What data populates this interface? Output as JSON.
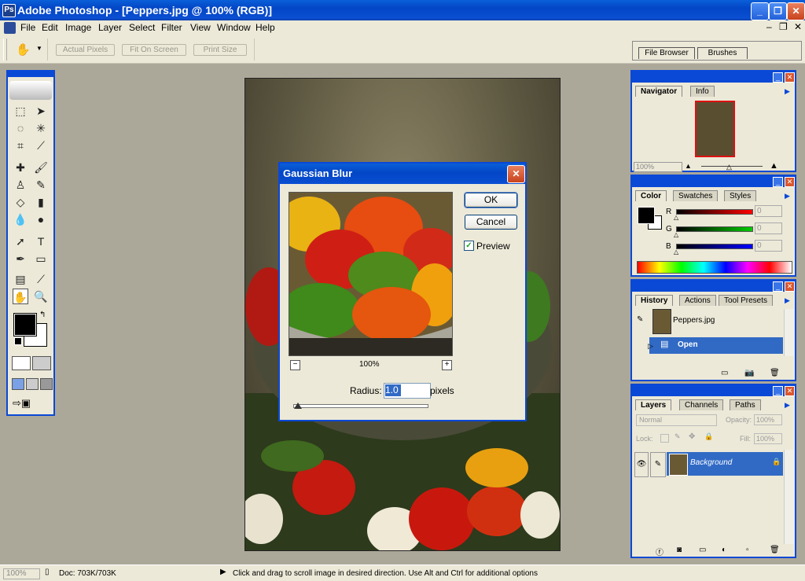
{
  "window": {
    "title": "Adobe Photoshop - [Peppers.jpg @ 100% (RGB)]"
  },
  "menu": [
    "File",
    "Edit",
    "Image",
    "Layer",
    "Select",
    "Filter",
    "View",
    "Window",
    "Help"
  ],
  "options_bar": {
    "actual_pixels": "Actual Pixels",
    "fit_on_screen": "Fit On Screen",
    "print_size": "Print Size"
  },
  "palette_well": {
    "file_browser": "File Browser",
    "brushes": "Brushes"
  },
  "dialog": {
    "title": "Gaussian Blur",
    "ok": "OK",
    "cancel": "Cancel",
    "preview_label": "Preview",
    "preview_checked": true,
    "zoom": "100%",
    "radius_label": "Radius:",
    "radius_value": "1.0",
    "radius_unit": "pixels",
    "minus": "−",
    "plus": "+"
  },
  "navigator": {
    "tabs": [
      "Navigator",
      "Info"
    ],
    "zoom": "100%"
  },
  "color": {
    "tabs": [
      "Color",
      "Swatches",
      "Styles"
    ],
    "channels": [
      {
        "label": "R",
        "value": "0"
      },
      {
        "label": "G",
        "value": "0"
      },
      {
        "label": "B",
        "value": "0"
      }
    ]
  },
  "history": {
    "tabs": [
      "History",
      "Actions",
      "Tool Presets"
    ],
    "snapshot": "Peppers.jpg",
    "states": [
      "Open"
    ]
  },
  "layers": {
    "tabs": [
      "Layers",
      "Channels",
      "Paths"
    ],
    "blend_mode": "Normal",
    "opacity_label": "Opacity:",
    "opacity": "100%",
    "lock_label": "Lock:",
    "fill_label": "Fill:",
    "fill": "100%",
    "layer_name": "Background"
  },
  "status": {
    "zoom": "100%",
    "doc": "Doc: 703K/703K",
    "hint": "Click and drag to scroll image in desired direction.  Use Alt and Ctrl for additional options"
  },
  "colors": {
    "xp_blue": "#0A48D6",
    "face": "#ECE9D8",
    "selection": "#316AC5"
  }
}
